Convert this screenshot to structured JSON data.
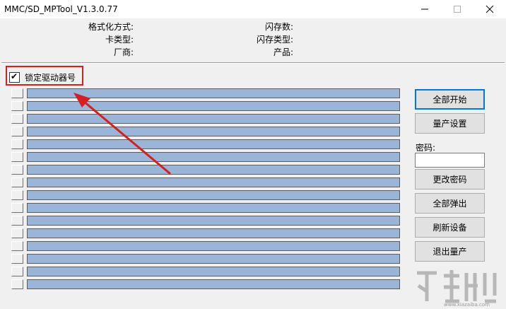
{
  "window": {
    "title": "MMC/SD_MPTool_V1.3.0.77",
    "controls": [
      "minimize-icon",
      "maximize-icon",
      "close-icon"
    ]
  },
  "info": {
    "format_method": "格式化方式:",
    "card_type": "卡类型:",
    "vendor": "厂商:",
    "flash_count": "闪存数:",
    "flash_type": "闪存类型:",
    "product": "产品:"
  },
  "lock_drive": {
    "label": "锁定驱动器号",
    "checked": true,
    "check_glyph": "✔"
  },
  "slots": {
    "count": 16,
    "bar_color": "#9bb5d8"
  },
  "buttons": {
    "start_all": "全部开始",
    "mp_settings": "量产设置",
    "change_password": "更改密码",
    "eject_all": "全部弹出",
    "refresh_devices": "刷新设备",
    "exit_mp": "退出量产"
  },
  "password": {
    "label": "密码:",
    "value": ""
  },
  "annotation": {
    "highlight_color": "#d42020"
  },
  "watermark": {
    "text": "www.xiazaiba.com"
  }
}
